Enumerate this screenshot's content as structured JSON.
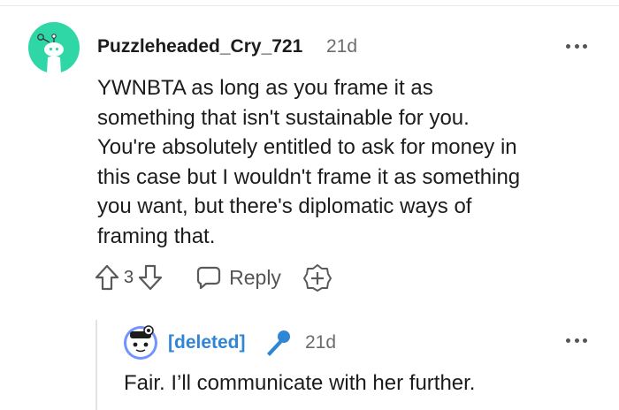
{
  "comment": {
    "username": "Puzzleheaded_Cry_721",
    "age": "21d",
    "body_lines": [
      "YWNBTA as long as you frame it as",
      "something that isn't sustainable for you.",
      "You're absolutely entitled to ask for money in",
      "this case but I wouldn't frame it as something",
      "you want, but there's diplomatic ways of",
      "framing that."
    ],
    "vote_count": "3",
    "reply_label": "Reply"
  },
  "reply": {
    "username": "[deleted]",
    "age": "21d",
    "body": "Fair. I’ll communicate with her further."
  },
  "icons": {
    "avatar": "snoo-avatar-icon",
    "upvote": "upvote-arrow-icon",
    "downvote": "downvote-arrow-icon",
    "reply": "speech-bubble-icon",
    "award": "award-plus-icon",
    "more": "more-options-icon",
    "flair": "microphone-icon"
  },
  "colors": {
    "avatar_bg": "#2fd6a6",
    "deleted_user": "#2f86d4",
    "mic": "#2f86d4",
    "muted_text": "#6c6c6c"
  }
}
